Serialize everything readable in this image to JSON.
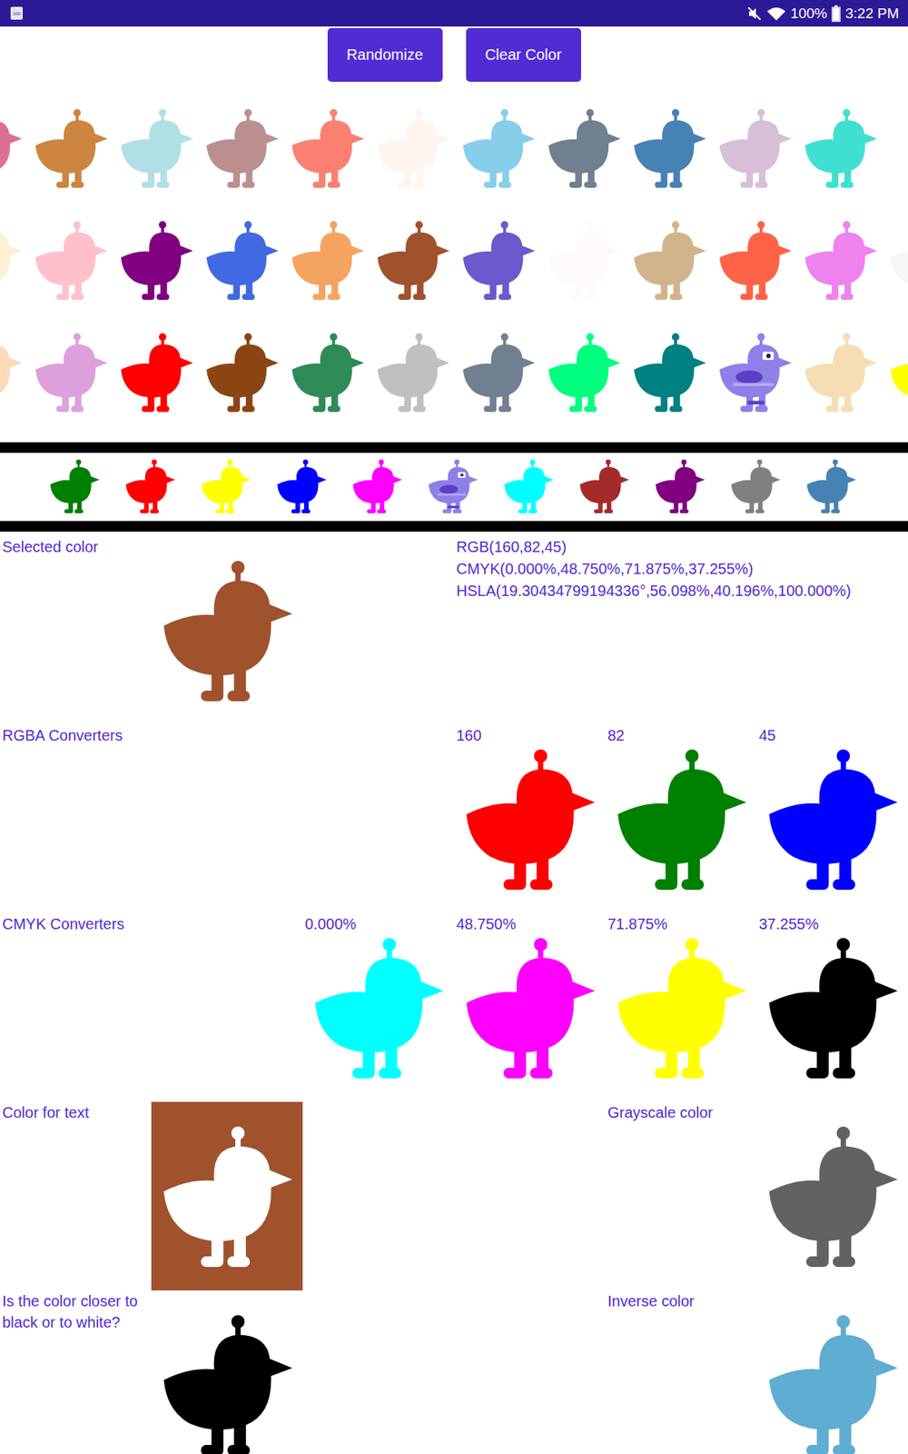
{
  "status_bar": {
    "badge": "100",
    "muted": true,
    "wifi_level": 1,
    "battery": "100%",
    "battery_level": 1,
    "time": "3:22 PM"
  },
  "buttons": [
    {
      "label": "Randomize"
    },
    {
      "label": "Clear Color"
    }
  ],
  "palette_rows": [
    {
      "swatches": [
        {
          "color": "#db7093",
          "kind": "swatch"
        },
        {
          "color": "#cd853f",
          "kind": "swatch"
        },
        {
          "color": "#b0e0e6",
          "kind": "swatch"
        },
        {
          "color": "#bc8f8f",
          "kind": "swatch"
        },
        {
          "color": "#fa8072",
          "kind": "swatch"
        },
        {
          "color": "#fff5ee",
          "kind": "swatch"
        },
        {
          "color": "#87ceeb",
          "kind": "swatch"
        },
        {
          "color": "#708090",
          "kind": "swatch"
        },
        {
          "color": "#4682b4",
          "kind": "swatch"
        },
        {
          "color": "#d8bfd8",
          "kind": "swatch"
        },
        {
          "color": "#40e0d0",
          "kind": "swatch"
        }
      ]
    },
    {
      "swatches": [
        {
          "color": "#ffefd5",
          "kind": "swatch"
        },
        {
          "color": "#ffc0cb",
          "kind": "swatch"
        },
        {
          "color": "#800080",
          "kind": "swatch"
        },
        {
          "color": "#4169e1",
          "kind": "swatch"
        },
        {
          "color": "#f4a460",
          "kind": "swatch"
        },
        {
          "color": "#a0522d",
          "kind": "swatch"
        },
        {
          "color": "#6a5acd",
          "kind": "swatch"
        },
        {
          "color": "#fffafa",
          "kind": "swatch"
        },
        {
          "color": "#d2b48c",
          "kind": "swatch"
        },
        {
          "color": "#ff6347",
          "kind": "swatch"
        },
        {
          "color": "#ee82ee",
          "kind": "swatch"
        },
        {
          "color": "#f5f5f5",
          "kind": "swatch"
        }
      ]
    },
    {
      "swatches": [
        {
          "color": "#ffdab9",
          "kind": "swatch"
        },
        {
          "color": "#dda0dd",
          "kind": "swatch"
        },
        {
          "color": "#ff0000",
          "kind": "swatch"
        },
        {
          "color": "#8b4513",
          "kind": "swatch"
        },
        {
          "color": "#2e8b57",
          "kind": "swatch"
        },
        {
          "color": "#c0c0c0",
          "kind": "swatch"
        },
        {
          "color": "#708090",
          "kind": "swatch"
        },
        {
          "color": "#00ff7f",
          "kind": "swatch"
        },
        {
          "color": "#008080",
          "kind": "swatch"
        },
        {
          "color": "#8f7fe8",
          "kind": "bot"
        },
        {
          "color": "#f5deb3",
          "kind": "swatch"
        },
        {
          "color": "#ffff00",
          "kind": "swatch"
        }
      ]
    }
  ],
  "recent_colors": [
    {
      "color": "#008000",
      "kind": "swatch"
    },
    {
      "color": "#ff0000",
      "kind": "swatch"
    },
    {
      "color": "#ffff00",
      "kind": "swatch"
    },
    {
      "color": "#0000ff",
      "kind": "swatch"
    },
    {
      "color": "#ff00ff",
      "kind": "swatch"
    },
    {
      "color": "#8f7fe8",
      "kind": "bot"
    },
    {
      "color": "#00ffff",
      "kind": "swatch"
    },
    {
      "color": "#a52a2a",
      "kind": "swatch"
    },
    {
      "color": "#800080",
      "kind": "swatch"
    },
    {
      "color": "#808080",
      "kind": "swatch"
    },
    {
      "color": "#4682b4",
      "kind": "swatch"
    }
  ],
  "selected": {
    "label": "Selected color",
    "color": "#a0522d",
    "readouts": [
      "RGB(160,82,45)",
      "CMYK(0.000%,48.750%,71.875%,37.255%)",
      "HSLA(19.30434799194336°,56.098%,40.196%,100.000%)"
    ]
  },
  "rgba": {
    "label": "RGBA Converters",
    "channels": [
      {
        "value": "160",
        "color": "#ff0000"
      },
      {
        "value": "82",
        "color": "#008000"
      },
      {
        "value": "45",
        "color": "#0000ff"
      }
    ]
  },
  "cmyk": {
    "label": "CMYK Converters",
    "channels": [
      {
        "value": "0.000%",
        "color": "#00ffff"
      },
      {
        "value": "48.750%",
        "color": "#ff00ff"
      },
      {
        "value": "71.875%",
        "color": "#ffff00"
      },
      {
        "value": "37.255%",
        "color": "#000000"
      }
    ]
  },
  "text_color": {
    "label": "Color for text",
    "background": "#a0522d",
    "color": "#ffffff"
  },
  "grayscale": {
    "label": "Grayscale color",
    "color": "#626262"
  },
  "contrast": {
    "label": "Is the color closer to black or to white?",
    "color": "#000000"
  },
  "inverse": {
    "label": "Inverse color",
    "color": "#5fadd2"
  }
}
